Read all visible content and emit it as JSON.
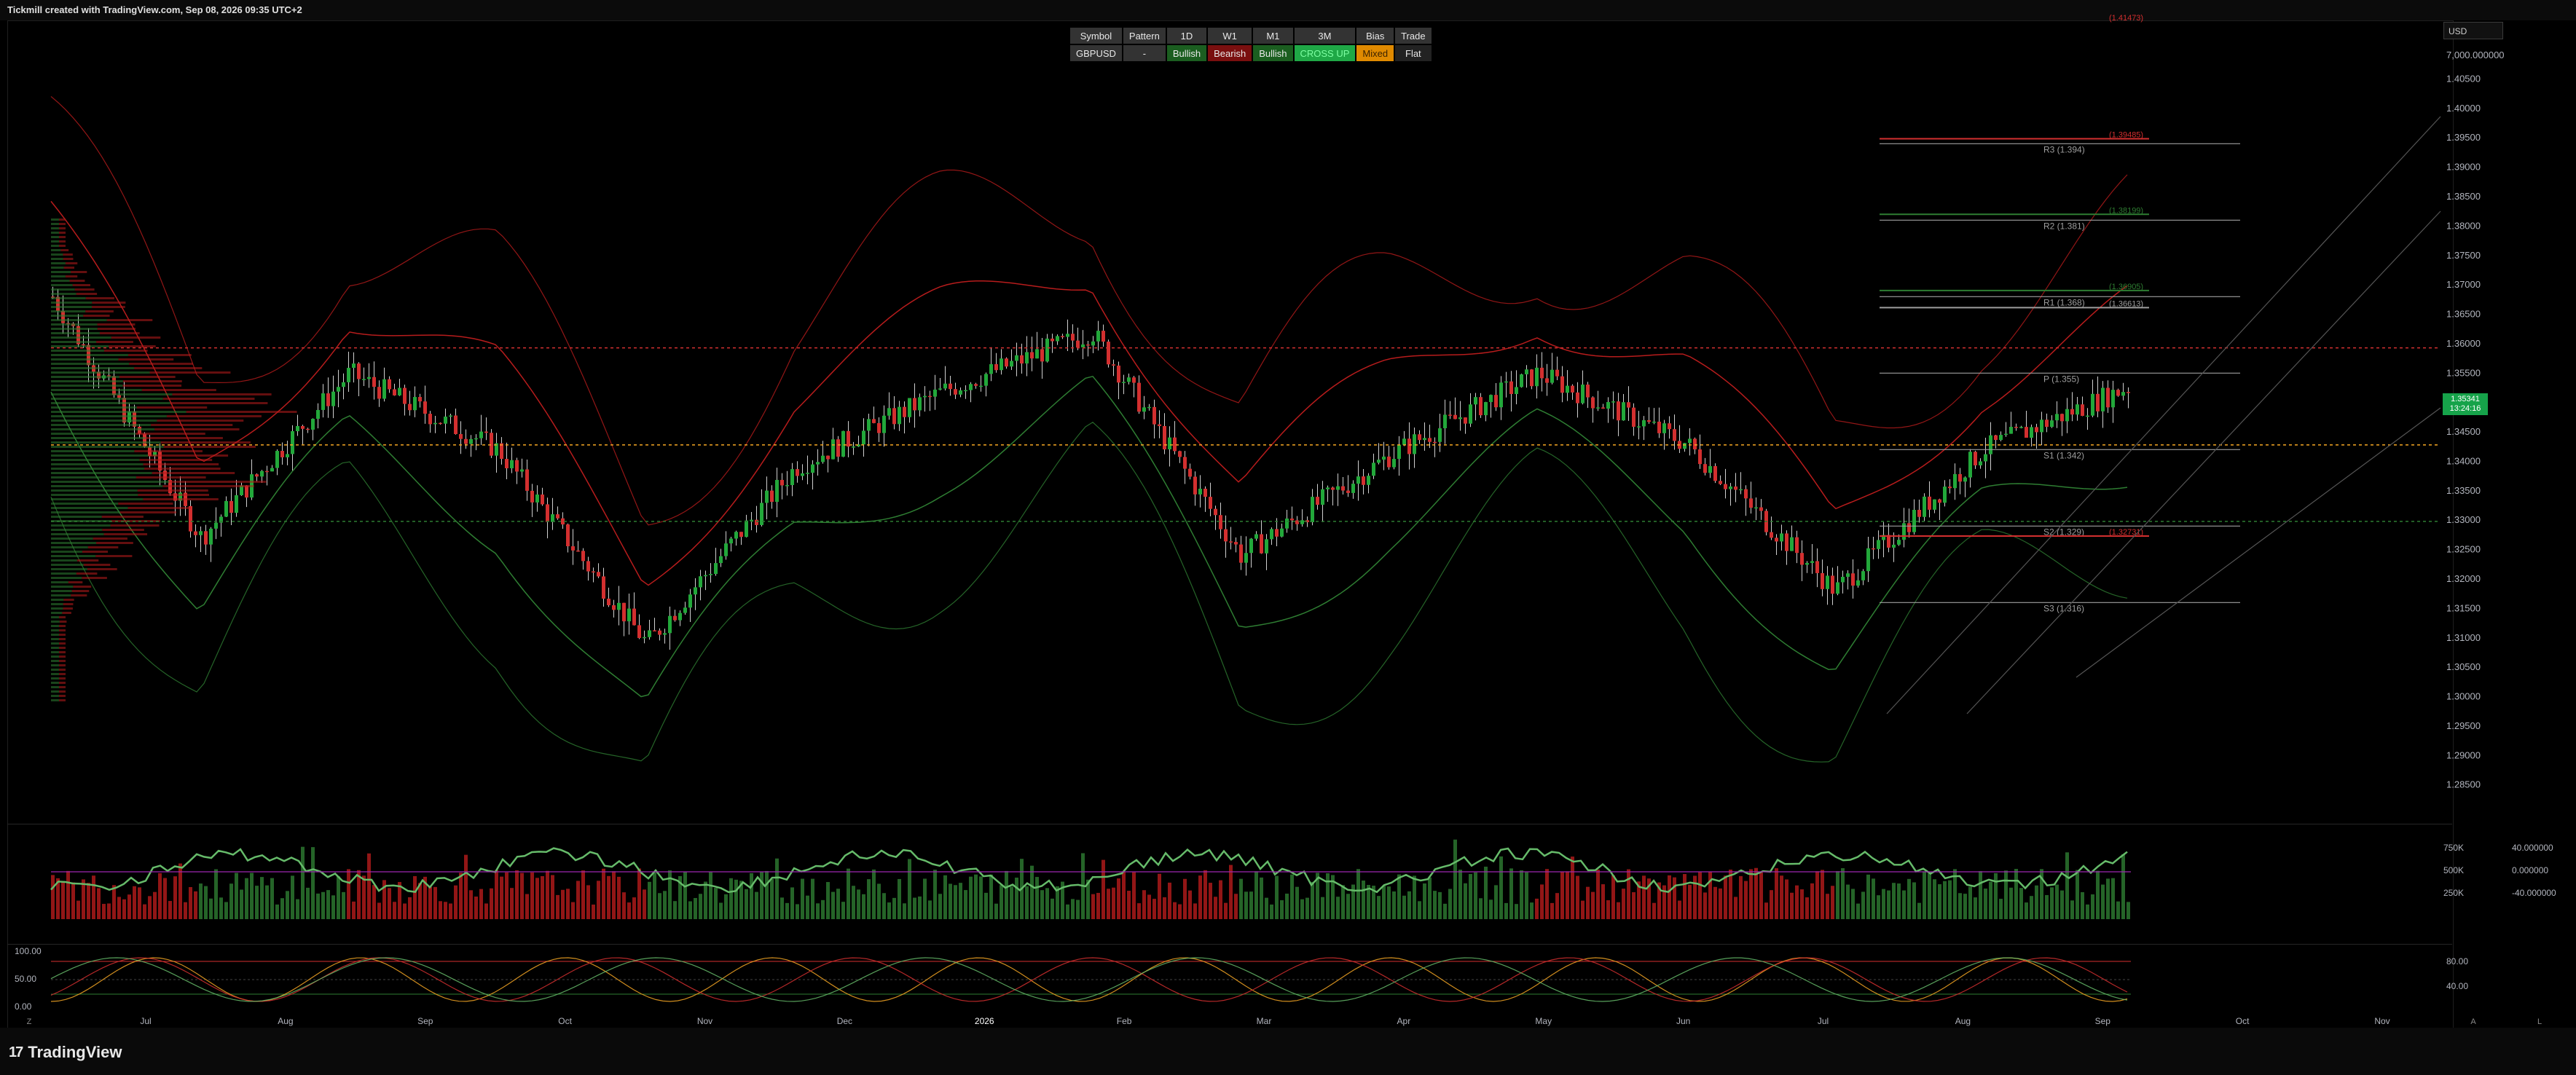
{
  "header": {
    "credit": "Tickmill created with TradingView.com, Sep 08, 2026 09:35 UTC+2"
  },
  "currency_selector": {
    "value": "USD"
  },
  "signal_table": {
    "headers": [
      "Symbol",
      "Pattern",
      "1D",
      "W1",
      "M1",
      "3M",
      "Bias",
      "Trade"
    ],
    "values": [
      "GBPUSD",
      "-",
      "Bullish",
      "Bearish",
      "Bullish",
      "CROSS UP",
      "Mixed",
      "Flat"
    ]
  },
  "price_box": {
    "price": "1.35341",
    "countdown": "13:24:16"
  },
  "footer": {
    "brand": "TradingView",
    "left_button": "Z",
    "right_buttons": [
      "A",
      "L"
    ]
  },
  "chart_data": {
    "type": "candlestick",
    "symbol": "GBPUSD",
    "x_ticks": [
      "Jul",
      "Aug",
      "Sep",
      "Oct",
      "Nov",
      "Dec",
      "2026",
      "Feb",
      "Mar",
      "Apr",
      "May",
      "Jun",
      "Jul",
      "Aug",
      "Sep",
      "Oct",
      "Nov"
    ],
    "y_axis": {
      "ticks": [
        "1.40500",
        "1.40000",
        "1.39500",
        "1.39000",
        "1.38500",
        "1.38000",
        "1.37500",
        "1.37000",
        "1.36500",
        "1.36000",
        "1.35500",
        "1.35000",
        "1.34500",
        "1.34000",
        "1.33500",
        "1.33000",
        "1.32500",
        "1.32000",
        "1.31500",
        "1.31000",
        "1.30500",
        "1.30000",
        "1.29500",
        "1.29000",
        "1.28500"
      ],
      "top_label": "7,000.000000",
      "ylim": [
        1.281,
        1.411
      ]
    },
    "monthly_closes": [
      {
        "month": "Jul",
        "value": 1.368
      },
      {
        "month": "Aug",
        "value": 1.327
      },
      {
        "month": "Sep",
        "value": 1.355
      },
      {
        "month": "Oct",
        "value": 1.342
      },
      {
        "month": "Nov",
        "value": 1.309
      },
      {
        "month": "Dec",
        "value": 1.339
      },
      {
        "month": "2026",
        "value": 1.352
      },
      {
        "month": "Feb",
        "value": 1.362
      },
      {
        "month": "Mar",
        "value": 1.324
      },
      {
        "month": "Apr",
        "value": 1.341
      },
      {
        "month": "May",
        "value": 1.355
      },
      {
        "month": "Jun",
        "value": 1.343
      },
      {
        "month": "Jul",
        "value": 1.318
      },
      {
        "month": "Aug",
        "value": 1.342
      },
      {
        "month": "Sep",
        "value": 1.353
      }
    ],
    "pivot_levels": [
      {
        "label": "R3 (1.394)",
        "value": 1.394
      },
      {
        "label": "R2 (1.381)",
        "value": 1.381
      },
      {
        "label": "R1 (1.368)",
        "value": 1.368
      },
      {
        "label": "P (1.355)",
        "value": 1.355
      },
      {
        "label": "S1 (1.342)",
        "value": 1.342
      },
      {
        "label": "S2 (1.329)",
        "value": 1.329
      },
      {
        "label": "S3 (1.316)",
        "value": 1.316
      }
    ],
    "marked_levels": [
      "(1.41473)",
      "(1.39485)",
      "(1.38199)",
      "(1.36905)",
      "(1.36613)",
      "(1.32731)"
    ],
    "volume_panel": {
      "right_axis": [
        "40.000000",
        "0.000000",
        "-40.000000"
      ],
      "left_axis": [
        "750K",
        "500K",
        "250K"
      ]
    },
    "stoch_panel": {
      "left_axis": [
        "100.00",
        "50.00",
        "0.00"
      ],
      "right_axis": [
        "80.00",
        "40.00"
      ]
    },
    "colors": {
      "up": "#22a83a",
      "down": "#d32f2f",
      "background": "#000000",
      "upper_band": "#b71c1c",
      "lower_band": "#2e7d32"
    }
  }
}
